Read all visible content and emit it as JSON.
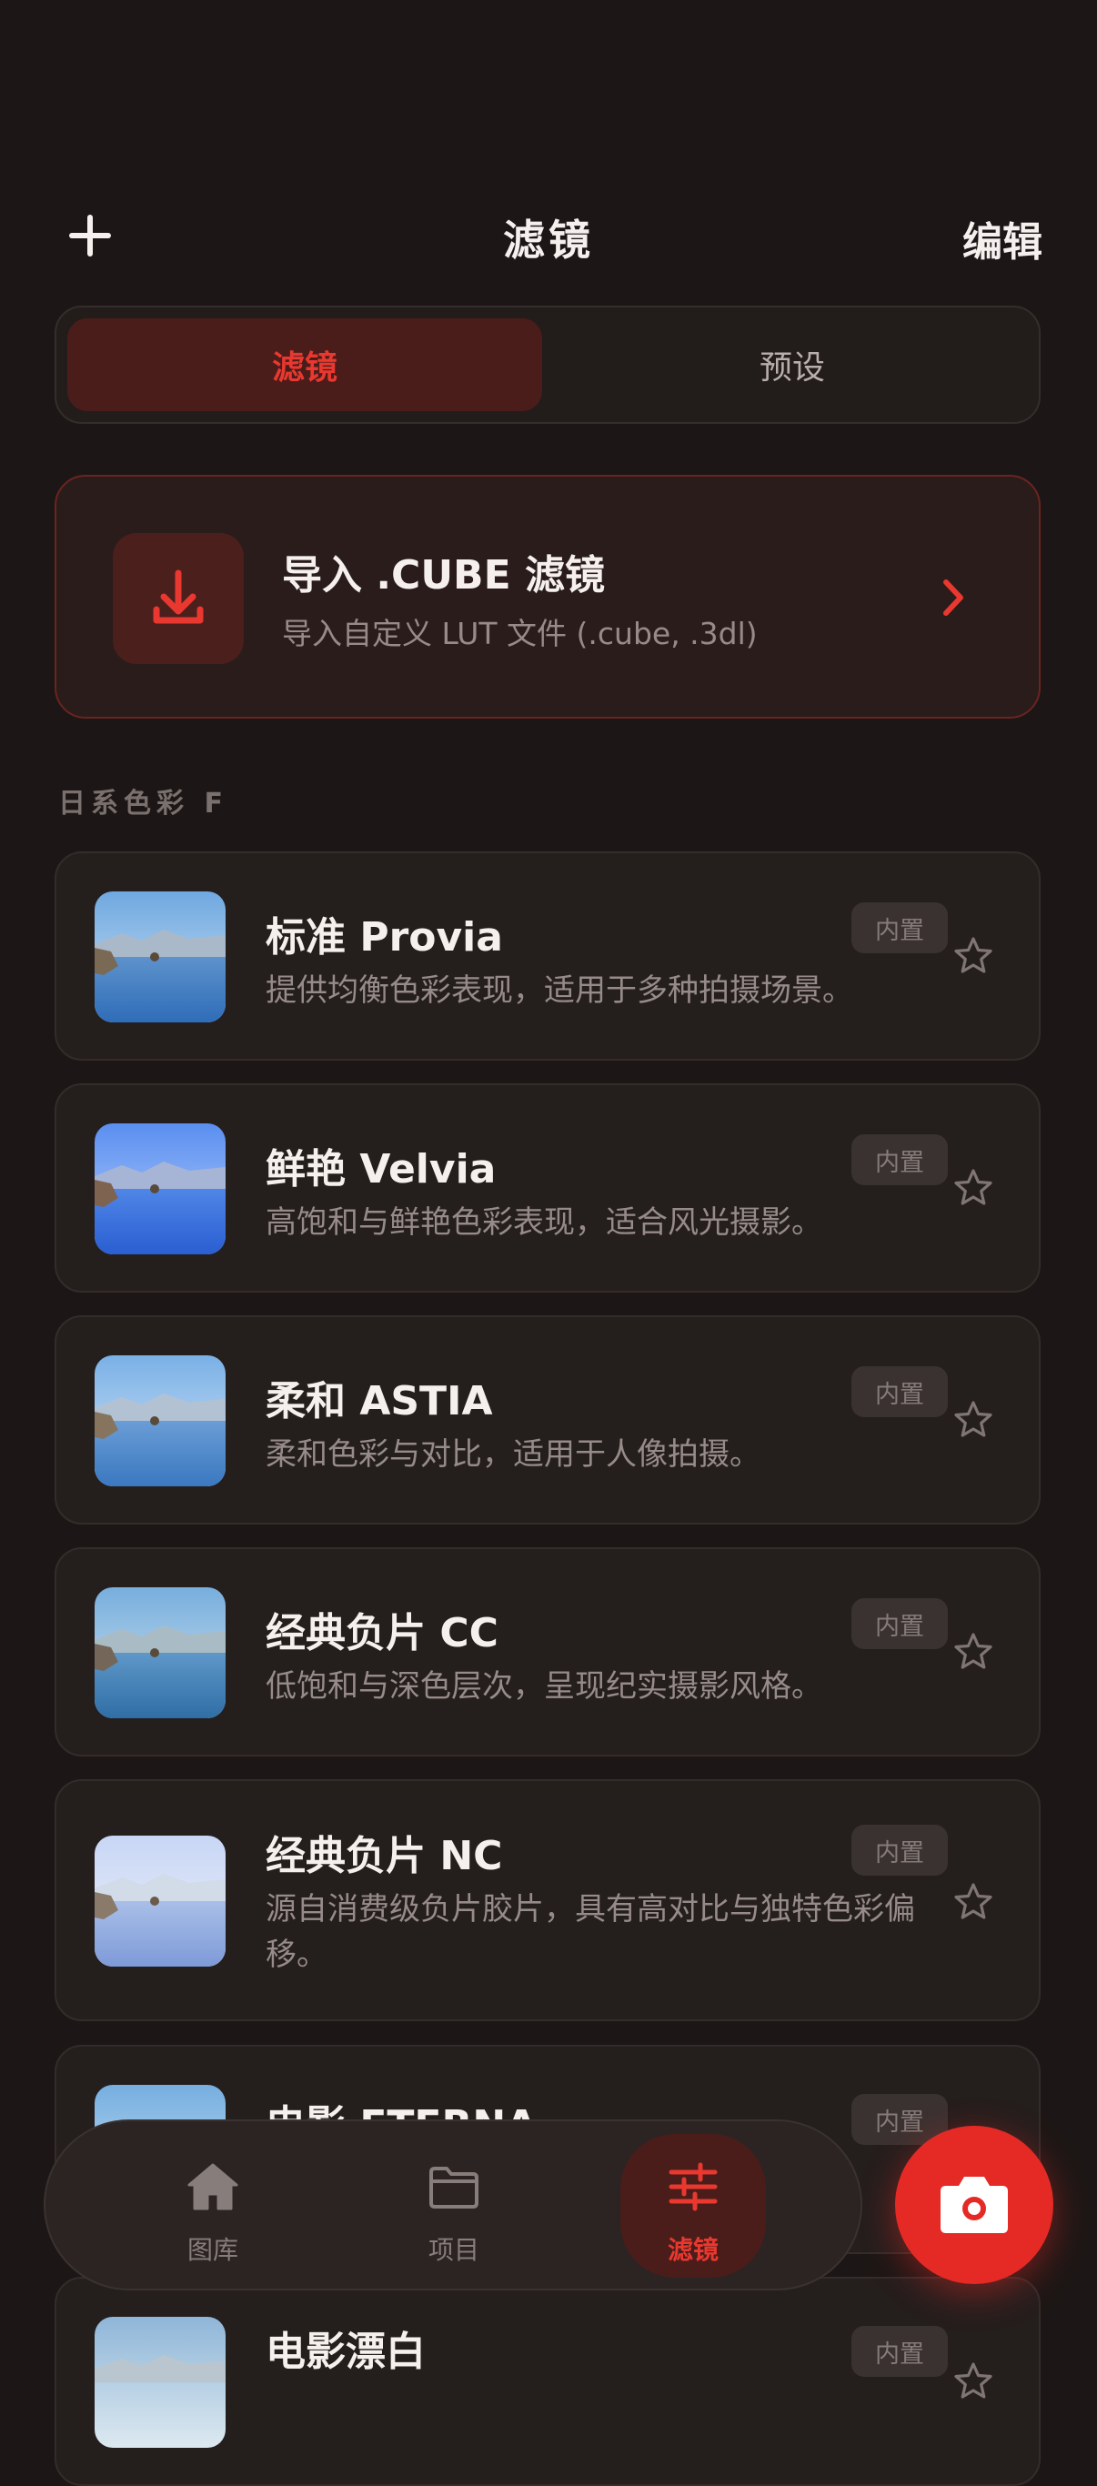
{
  "header": {
    "title": "滤镜",
    "edit_label": "编辑"
  },
  "segment": {
    "tabs": [
      {
        "label": "滤镜",
        "active": true
      },
      {
        "label": "预设",
        "active": false
      }
    ]
  },
  "import": {
    "title": "导入 .CUBE 滤镜",
    "subtitle": "导入自定义 LUT 文件 (.cube, .3dl)"
  },
  "section": {
    "title": "日系色彩 F"
  },
  "filters": [
    {
      "name": "标准 Provia",
      "desc": "提供均衡色彩表现，适用于多种拍摄场景。",
      "badge": "内置"
    },
    {
      "name": "鲜艳 Velvia",
      "desc": "高饱和与鲜艳色彩表现，适合风光摄影。",
      "badge": "内置"
    },
    {
      "name": "柔和 ASTIA",
      "desc": "柔和色彩与对比，适用于人像拍摄。",
      "badge": "内置"
    },
    {
      "name": "经典负片 CC",
      "desc": "低饱和与深色层次，呈现纪实摄影风格。",
      "badge": "内置"
    },
    {
      "name": "经典负片 NC",
      "desc": "源自消费级负片胶片，具有高对比与独特色彩偏移。",
      "badge": "内置"
    },
    {
      "name": "电影 ETERNA",
      "desc": "",
      "badge": "内置"
    },
    {
      "name": "电影漂白",
      "desc": "",
      "badge": "内置"
    }
  ],
  "tabbar": {
    "items": [
      {
        "label": "图库"
      },
      {
        "label": "项目"
      },
      {
        "label": "滤镜"
      }
    ]
  },
  "colors": {
    "accent": "#e8382f",
    "background": "#1c1716",
    "card": "#241e1d"
  }
}
